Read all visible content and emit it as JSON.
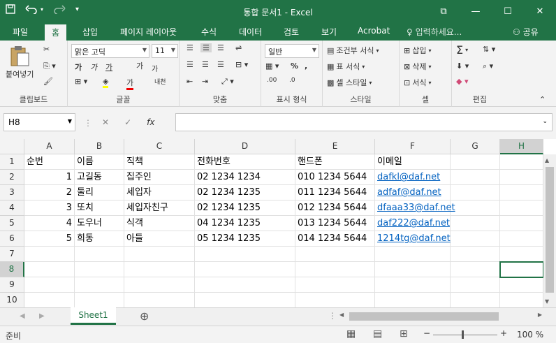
{
  "app": {
    "title": "통합 문서1 - Excel",
    "accent": "#217346"
  },
  "qat": {
    "save_icon": "save-icon",
    "undo_icon": "undo-icon",
    "redo_icon": "redo-icon",
    "customize": "▾"
  },
  "tabs": [
    "파일",
    "홈",
    "삽입",
    "페이지 레이아웃",
    "수식",
    "데이터",
    "검토",
    "보기",
    "Acrobat"
  ],
  "tell_me": "입력하세요...",
  "share": "공유",
  "ribbon": {
    "clipboard": {
      "paste": "붙여넣기",
      "label": "클립보드"
    },
    "font": {
      "name": "맑은 고딕",
      "size": "11",
      "label": "글꼴",
      "bold": "가",
      "italic": "가",
      "underline": "가",
      "grow": "가",
      "shrink": "가",
      "color_a": "가",
      "phonetic": "내천"
    },
    "align": {
      "label": "맞춤"
    },
    "number": {
      "format": "일반",
      "label": "표시 형식"
    },
    "styles": {
      "cond": "조건부 서식",
      "table": "표 서식",
      "cell": "셀 스타일",
      "label": "스타일"
    },
    "cells": {
      "insert": "삽입",
      "delete": "삭제",
      "format": "서식",
      "label": "셀"
    },
    "editing": {
      "label": "편집"
    }
  },
  "formula_bar": {
    "name_box": "H8",
    "fx": "fx",
    "formula": ""
  },
  "columns": [
    "A",
    "B",
    "C",
    "D",
    "E",
    "F",
    "G",
    "H"
  ],
  "rows": [
    "1",
    "2",
    "3",
    "4",
    "5",
    "6",
    "7",
    "8",
    "9",
    "10"
  ],
  "cells": [
    [
      "순번",
      "이름",
      "직책",
      "전화번호",
      "핸드폰",
      "이메일"
    ],
    [
      "1",
      "고길동",
      "집주인",
      "02 1234 1234",
      "010 1234 5644",
      "dafkl@daf.net"
    ],
    [
      "2",
      "둘리",
      "세입자",
      "02 1234 1235",
      "011 1234 5644",
      "adfaf@daf.net"
    ],
    [
      "3",
      "또치",
      "세입자친구",
      "02 1234 1235",
      "012 1234 5644",
      "dfaaa33@daf.net"
    ],
    [
      "4",
      "도우너",
      "식객",
      "04 1234 1235",
      "013 1234 5644",
      "daf222@daf.net"
    ],
    [
      "5",
      "희동",
      "아들",
      "05 1234 1235",
      "014 1234 5644",
      "1214tg@daf.net"
    ]
  ],
  "sheet": {
    "tab": "Sheet1",
    "add": "⊕"
  },
  "status": {
    "ready": "준비",
    "zoom": "100 %"
  }
}
